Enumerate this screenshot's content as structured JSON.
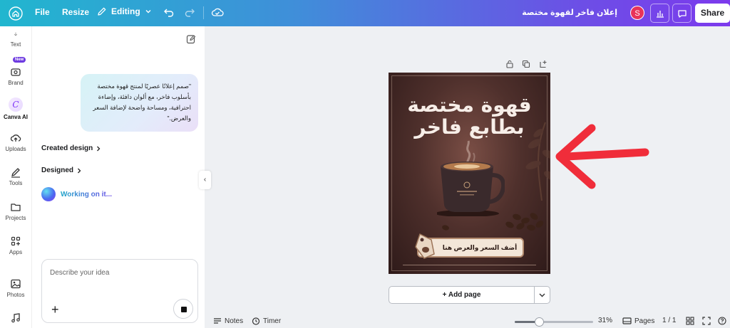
{
  "topbar": {
    "file_label": "File",
    "resize_label": "Resize",
    "editing_label": "Editing",
    "doc_title": "إعلان فاخر لقهوة مختصة",
    "avatar_initial": "S",
    "share_label": "Share"
  },
  "rail": {
    "items": [
      {
        "label": "Text"
      },
      {
        "label": "Brand"
      },
      {
        "label": "Canva AI"
      },
      {
        "label": "Uploads"
      },
      {
        "label": "Tools"
      },
      {
        "label": "Projects"
      },
      {
        "label": "Apps"
      },
      {
        "label": "Photos"
      }
    ],
    "new_badge": "New"
  },
  "panel": {
    "prompt_bubble": "\"صمم إعلانًا عصريًا لمنتج قهوة مختصة بأسلوب فاخر، مع ألوان دافئة، وإضاءة احترافية، ومساحة واضحة لإضافة السعر والعرض.\"",
    "created_design_label": "Created design",
    "designed_label": "Designed",
    "working_label": "Working on it...",
    "input_placeholder": "Describe your idea"
  },
  "design": {
    "headline": "قهوة مختصة بطابع فاخر",
    "price_text": "أضف السعر والعرض هنا"
  },
  "canvas": {
    "add_page_label": "+ Add page"
  },
  "bottombar": {
    "notes_label": "Notes",
    "timer_label": "Timer",
    "zoom_percent": "31%",
    "zoom_value": 0.31,
    "pages_label": "Pages",
    "page_counter": "1 / 1"
  },
  "colors": {
    "accent": "#7c3aed",
    "arrow": "#f02d3a"
  }
}
